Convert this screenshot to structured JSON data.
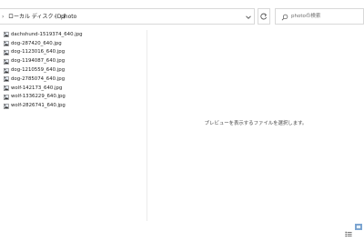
{
  "address_bar": {
    "breadcrumbs": [
      "ローカル ディスク (D:)",
      "photo"
    ]
  },
  "search": {
    "placeholder": "photoの検索"
  },
  "files": [
    "dachshund-1519374_640.jpg",
    "dog-287420_640.jpg",
    "dog-1123016_640.jpg",
    "dog-1194087_640.jpg",
    "dog-1210559_640.jpg",
    "dog-2785074_640.jpg",
    "wolf-142173_640.jpg",
    "wolf-1336229_640.jpg",
    "wolf-2826741_640.jpg"
  ],
  "preview": {
    "message": "プレビューを表示するファイルを選択します。"
  },
  "icons": {
    "file": "jpg-file-icon",
    "refresh": "refresh-icon",
    "search": "search-icon",
    "dropdown": "chevron-down-icon",
    "view_details": "details-view-icon",
    "view_large": "large-icons-view-icon"
  },
  "colors": {
    "accent": "#0067c0",
    "border": "#d9d9d9"
  }
}
